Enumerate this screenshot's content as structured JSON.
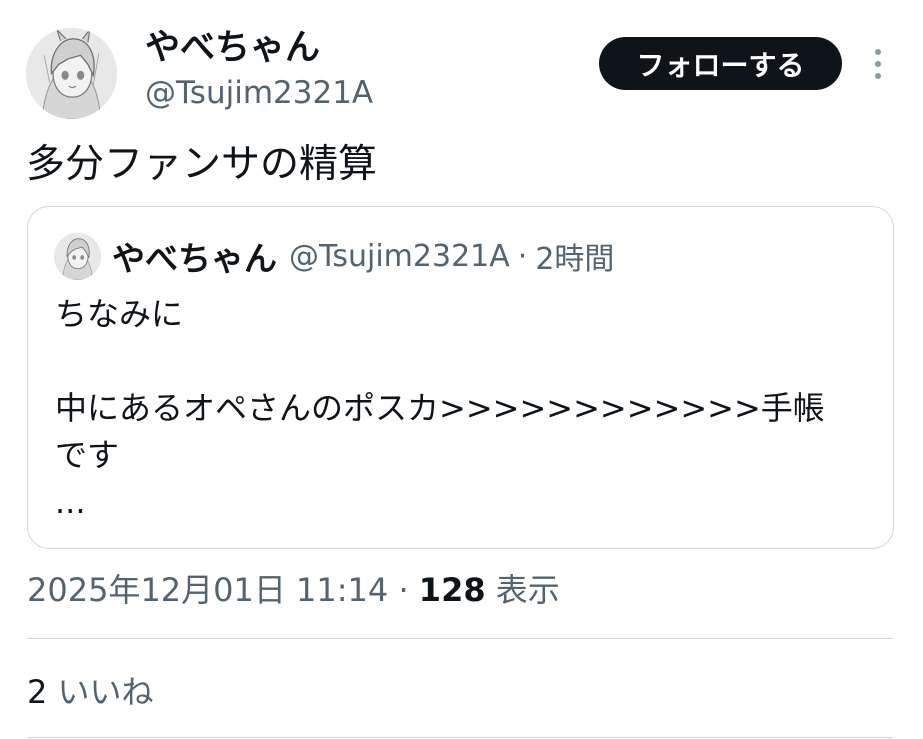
{
  "tweet": {
    "author": {
      "display_name": "やべちゃん",
      "handle": "@Tsujim2321A"
    },
    "follow_label": "フォローする",
    "text": "多分ファンサの精算",
    "quote": {
      "display_name": "やべちゃん",
      "handle": "@Tsujim2321A",
      "separator": "·",
      "time": "2時間",
      "lines": [
        "ちなみに",
        "",
        "中にあるオペさんのポスカ>>>>>>>>>>>>手帳",
        "です",
        "..."
      ]
    },
    "meta": {
      "timestamp": "2025年12月01日 11:14",
      "separator": "·",
      "views_count": "128",
      "views_label": "表示"
    },
    "likes": {
      "count": "2",
      "label": "いいね"
    }
  },
  "icons": {
    "more": "more-vertical-icon",
    "avatar": "avatar-sketch"
  },
  "colors": {
    "text_primary": "#0f1419",
    "text_secondary": "#536471",
    "border": "#cfd9de",
    "follow_bg": "#0f1419",
    "follow_text": "#ffffff"
  }
}
